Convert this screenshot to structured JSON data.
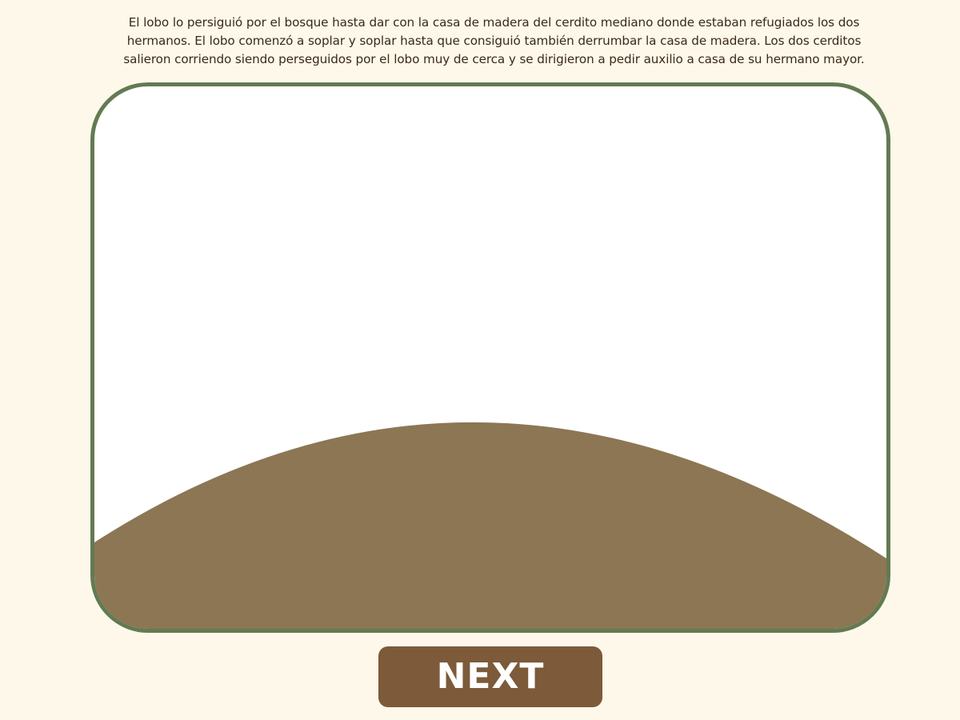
{
  "story": {
    "text": "El lobo lo persiguió por el bosque hasta dar con la casa de madera del cerdito mediano donde estaban refugiados los dos hermanos. El lobo comenzó a soplar y soplar hasta que consiguió también derrumbar la casa de madera. Los dos cerditos salieron corriendo siendo perseguidos por el lobo muy de cerca y se dirigieron a pedir auxilio a casa de su hermano mayor."
  },
  "scene": {
    "background_color": "#ffffff",
    "frame_color": "#637a52",
    "hill_color": "#8c7654"
  },
  "navigation": {
    "next_label": "NEXT",
    "button_color": "#7d5a39"
  }
}
